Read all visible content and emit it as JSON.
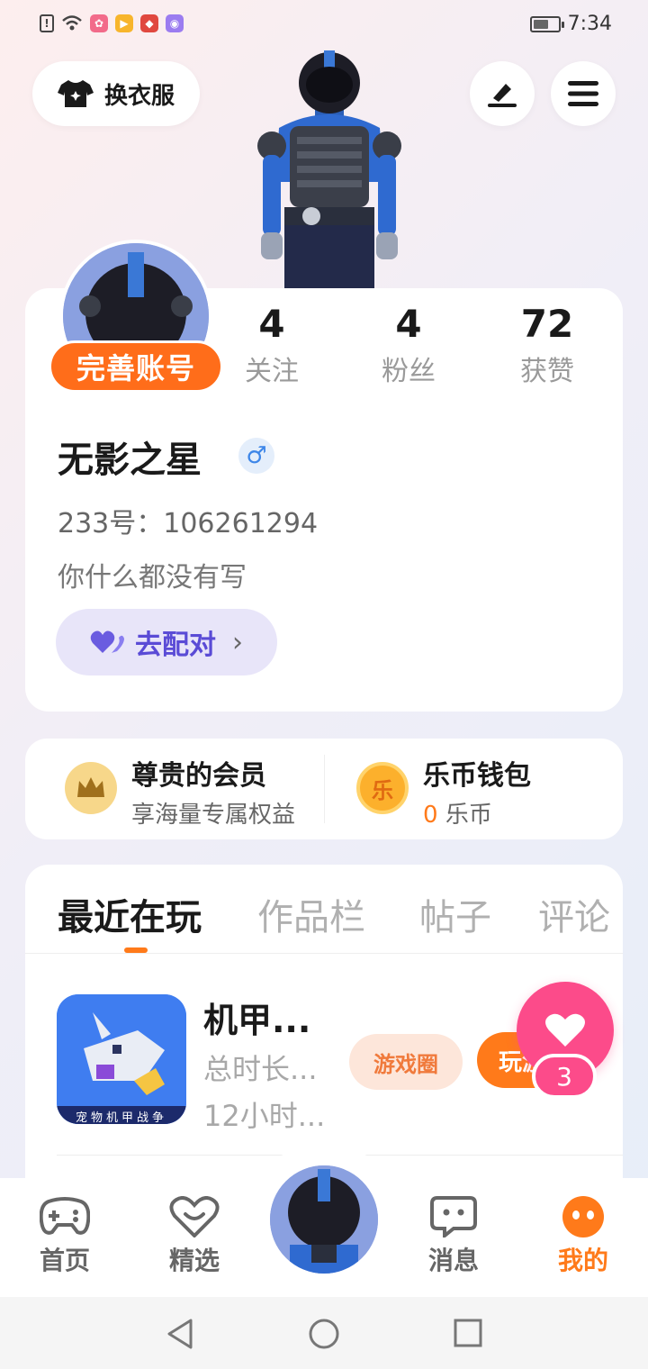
{
  "status_bar": {
    "time": "7:34",
    "icons": [
      "alert-icon",
      "wifi-icon",
      "app-icon-1",
      "app-icon-2",
      "app-icon-3",
      "app-icon-4"
    ]
  },
  "header": {
    "outfit_label": "换衣服",
    "edit_icon": "pen-icon",
    "menu_icon": "hamburger-menu-icon"
  },
  "profile": {
    "complete_badge": "完善账号",
    "stats": [
      {
        "value": "4",
        "label": "关注"
      },
      {
        "value": "4",
        "label": "粉丝"
      },
      {
        "value": "72",
        "label": "获赞"
      }
    ],
    "username": "无影之星",
    "gender_symbol": "♂",
    "uid_text": "233号：106261294",
    "bio": "你什么都没有写",
    "match_label": "去配对",
    "match_chevron": "›"
  },
  "vip": {
    "title": "尊贵的会员",
    "subtitle": "享海量专属权益"
  },
  "wallet": {
    "icon_char": "乐",
    "title": "乐币钱包",
    "amount": "0",
    "unit": "乐币"
  },
  "tabs": [
    "最近在玩",
    "作品栏",
    "帖子",
    "评论"
  ],
  "game": {
    "title": "机甲...",
    "time_label": "总时长...",
    "hours": "12小时...",
    "icon_caption": "宠物机甲战争",
    "circle_label": "游戏圈",
    "play_label": "玩游"
  },
  "like_fab": {
    "count": "3"
  },
  "bottom_nav": [
    {
      "label": "首页",
      "icon": "gamepad-icon"
    },
    {
      "label": "精选",
      "icon": "heart-chat-icon"
    },
    {
      "label": "消息",
      "icon": "message-icon"
    },
    {
      "label": "我的",
      "icon": "face-icon"
    }
  ],
  "colors": {
    "accent": "#ff7a1a",
    "like": "#fc4b8a",
    "match_purple": "#5a4bd6"
  }
}
